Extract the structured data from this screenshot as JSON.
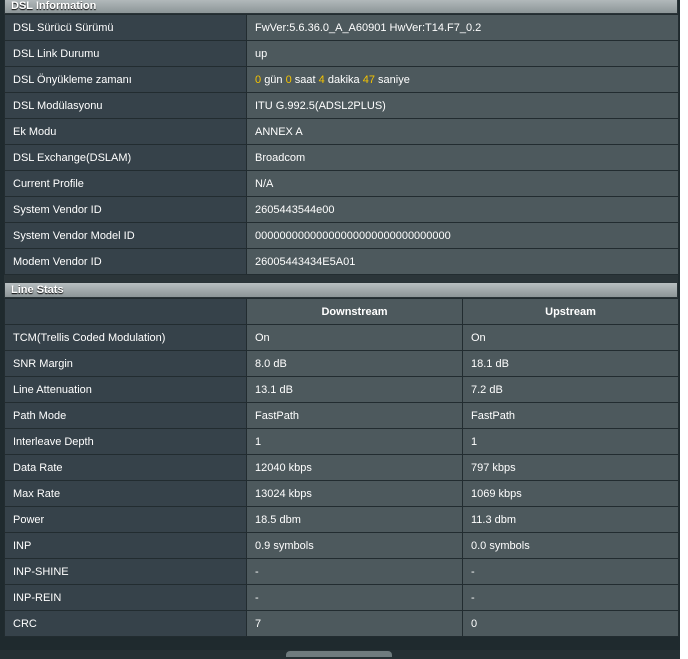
{
  "dsl_info": {
    "title": "DSL Information",
    "rows": [
      {
        "label": "DSL Sürücü Sürümü",
        "value": "FwVer:5.6.36.0_A_A60901 HwVer:T14.F7_0.2"
      },
      {
        "label": "DSL Link Durumu",
        "value": "up"
      },
      {
        "label": "DSL Önyükleme zamanı",
        "uptime": {
          "days": "0",
          "days_unit": "gün",
          "hours": "0",
          "hours_unit": "saat",
          "minutes": "4",
          "minutes_unit": "dakika",
          "seconds": "47",
          "seconds_unit": "saniye"
        }
      },
      {
        "label": "DSL Modülasyonu",
        "value": "ITU G.992.5(ADSL2PLUS)"
      },
      {
        "label": "Ek Modu",
        "value": "ANNEX A"
      },
      {
        "label": "DSL Exchange(DSLAM)",
        "value": "Broadcom"
      },
      {
        "label": "Current Profile",
        "value": "N/A"
      },
      {
        "label": "System Vendor ID",
        "value": "2605443544e00"
      },
      {
        "label": "System Vendor Model ID",
        "value": "00000000000000000000000000000000"
      },
      {
        "label": "Modem Vendor ID",
        "value": "26005443434E5A01"
      }
    ]
  },
  "line_stats": {
    "title": "Line Stats",
    "columns": [
      "Downstream",
      "Upstream"
    ],
    "rows": [
      {
        "label": "TCM(Trellis Coded Modulation)",
        "down": "On",
        "up": "On"
      },
      {
        "label": "SNR Margin",
        "down": "8.0 dB",
        "up": "18.1 dB"
      },
      {
        "label": "Line Attenuation",
        "down": "13.1 dB",
        "up": "7.2 dB"
      },
      {
        "label": "Path Mode",
        "down": "FastPath",
        "up": "FastPath"
      },
      {
        "label": "Interleave Depth",
        "down": "1",
        "up": "1"
      },
      {
        "label": "Data Rate",
        "down": "12040 kbps",
        "up": "797 kbps"
      },
      {
        "label": "Max Rate",
        "down": "13024 kbps",
        "up": "1069 kbps"
      },
      {
        "label": "Power",
        "down": "18.5 dbm",
        "up": "11.3 dbm"
      },
      {
        "label": "INP",
        "down": "0.9 symbols",
        "up": "0.0 symbols"
      },
      {
        "label": "INP-SHINE",
        "down": "-",
        "up": "-"
      },
      {
        "label": "INP-REIN",
        "down": "-",
        "up": "-"
      },
      {
        "label": "CRC",
        "down": "7",
        "up": "0"
      }
    ]
  },
  "colors": {
    "highlight": "#f5c400",
    "label_bg": "#36424a",
    "value_bg": "#4d595d"
  }
}
